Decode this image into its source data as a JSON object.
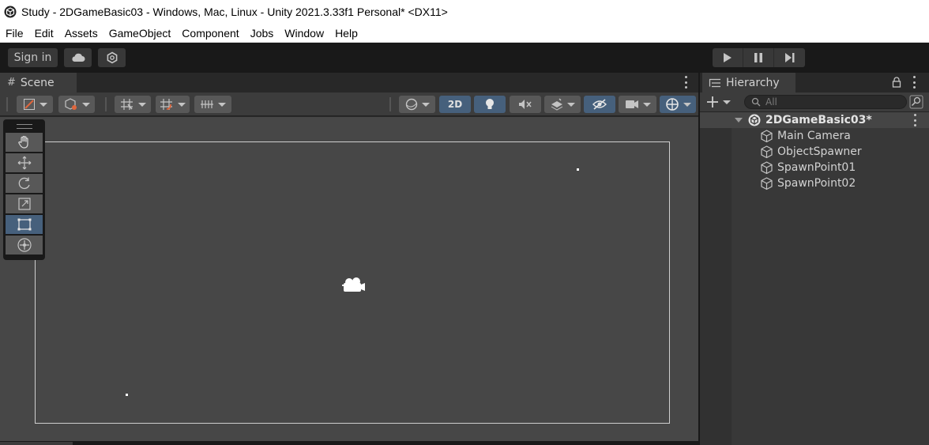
{
  "window": {
    "title": "Study - 2DGameBasic03 - Windows, Mac, Linux - Unity 2021.3.33f1 Personal* <DX11>"
  },
  "menu": {
    "items": [
      "File",
      "Edit",
      "Assets",
      "GameObject",
      "Component",
      "Jobs",
      "Window",
      "Help"
    ]
  },
  "toolbar": {
    "sign_in_label": "Sign in",
    "icons": [
      "cloud-icon",
      "collab-icon",
      "play-icon",
      "pause-icon",
      "step-icon"
    ]
  },
  "scene_panel": {
    "tab_label": "Scene",
    "toggle_2d_label": "2D",
    "tools": [
      "hand-tool",
      "move-tool",
      "rotate-tool",
      "scale-tool",
      "rect-tool",
      "transform-tool"
    ],
    "active_tool": "rect-tool"
  },
  "hierarchy": {
    "tab_label": "Hierarchy",
    "search_placeholder": "All",
    "scene_name": "2DGameBasic03*",
    "objects": [
      "Main Camera",
      "ObjectSpawner",
      "SpawnPoint01",
      "SpawnPoint02"
    ]
  },
  "colors": {
    "active_toggle": "#46607c",
    "panel_bg": "#383838",
    "scene_view_bg": "#474747"
  }
}
